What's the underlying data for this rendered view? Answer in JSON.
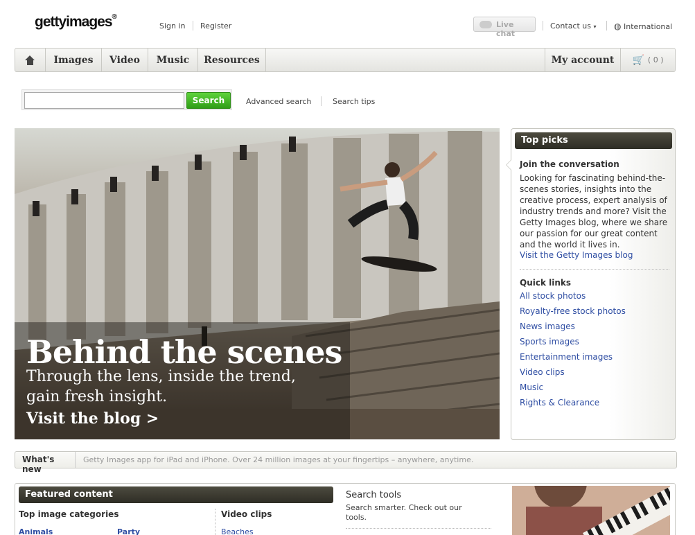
{
  "header": {
    "logo": "gettyimages",
    "logo_mark": "®",
    "sign_in": "Sign in",
    "register": "Register",
    "live_chat": "Live chat",
    "contact_us": "Contact us",
    "international": "International"
  },
  "nav": {
    "items": [
      "Images",
      "Video",
      "Music",
      "Resources"
    ],
    "my_account": "My account",
    "cart_count": "( 0 )"
  },
  "search": {
    "input_value": "",
    "button": "Search",
    "advanced": "Advanced search",
    "tips": "Search tips"
  },
  "hero": {
    "title": "Behind the scenes",
    "subtitle_line1": "Through the lens, inside the trend,",
    "subtitle_line2": "gain fresh insight.",
    "link": "Visit the blog >"
  },
  "sidebar": {
    "header": "Top picks",
    "join_title": "Join the conversation",
    "join_text": "Looking for fascinating behind-the-scenes stories, insights into the creative process, expert analysis of industry trends and more? Visit the Getty Images blog, where we share our passion for our great content and the world it lives in.",
    "join_link": "Visit the Getty Images blog",
    "quick_links_title": "Quick links",
    "quick_links": [
      "All stock photos",
      "Royalty-free stock photos",
      "News images",
      "Sports images",
      "Entertainment images",
      "Video clips",
      "Music",
      "Rights & Clearance"
    ]
  },
  "whats_new": {
    "label": "What's new",
    "text": "Getty Images app for iPad and iPhone. Over 24 million images at your fingertips – anywhere, anytime."
  },
  "featured": {
    "header": "Featured content",
    "top_image_categories": "Top image categories",
    "video_clips": "Video clips",
    "links": [
      "Animals",
      "Party",
      "Beaches"
    ]
  },
  "search_tools": {
    "title": "Search tools",
    "text": "Search smarter. Check out our tools."
  }
}
